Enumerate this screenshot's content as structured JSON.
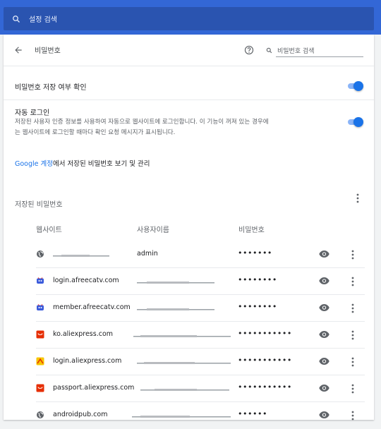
{
  "search": {
    "placeholder": "설정 검색"
  },
  "header": {
    "title": "비밀번호",
    "search_placeholder": "비밀번호 검색"
  },
  "settings": {
    "offer_to_save": {
      "label": "비밀번호 저장 여부 확인",
      "enabled": true
    },
    "auto_signin": {
      "label": "자동 로그인",
      "description_line1": "저장된 사용자 인증 정보를 사용하여 자동으로 웹사이트에 로그인합니다. 이 기능이 꺼져 있는 경우에",
      "description_line2": "는 웹사이트에 로그인할 때마다 확인 요청 메시지가 표시됩니다.",
      "enabled": true
    },
    "google_link": {
      "link_text": "Google 계정",
      "rest_text": "에서 저장된 비밀번호 보기 및 관리"
    }
  },
  "saved": {
    "heading": "저장된 비밀번호",
    "columns": {
      "website": "웹사이트",
      "username": "사용자이름",
      "password": "비밀번호"
    },
    "rows": [
      {
        "site": "",
        "site_icon": "globe-icon",
        "username": "admin",
        "password": "•••••••"
      },
      {
        "site": "login.afreecatv.com",
        "site_icon": "afreecatv-icon",
        "username": "",
        "password": "••••••••"
      },
      {
        "site": "member.afreecatv.com",
        "site_icon": "afreecatv-icon",
        "username": "",
        "password": "••••••••"
      },
      {
        "site": "ko.aliexpress.com",
        "site_icon": "aliexpress-icon",
        "username": "",
        "password": "•••••••••••"
      },
      {
        "site": "login.aliexpress.com",
        "site_icon": "aliexpress-login-icon",
        "username": "",
        "password": "•••••••••••"
      },
      {
        "site": "passport.aliexpress.com",
        "site_icon": "aliexpress-icon",
        "username": "",
        "password": "•••••••••••"
      },
      {
        "site": "androidpub.com",
        "site_icon": "globe-icon",
        "username": "",
        "password": "••••••"
      }
    ]
  },
  "colors": {
    "topbar": "#3367d6",
    "accent": "#1a73e8",
    "toggle_track": "#8ab4f8"
  }
}
